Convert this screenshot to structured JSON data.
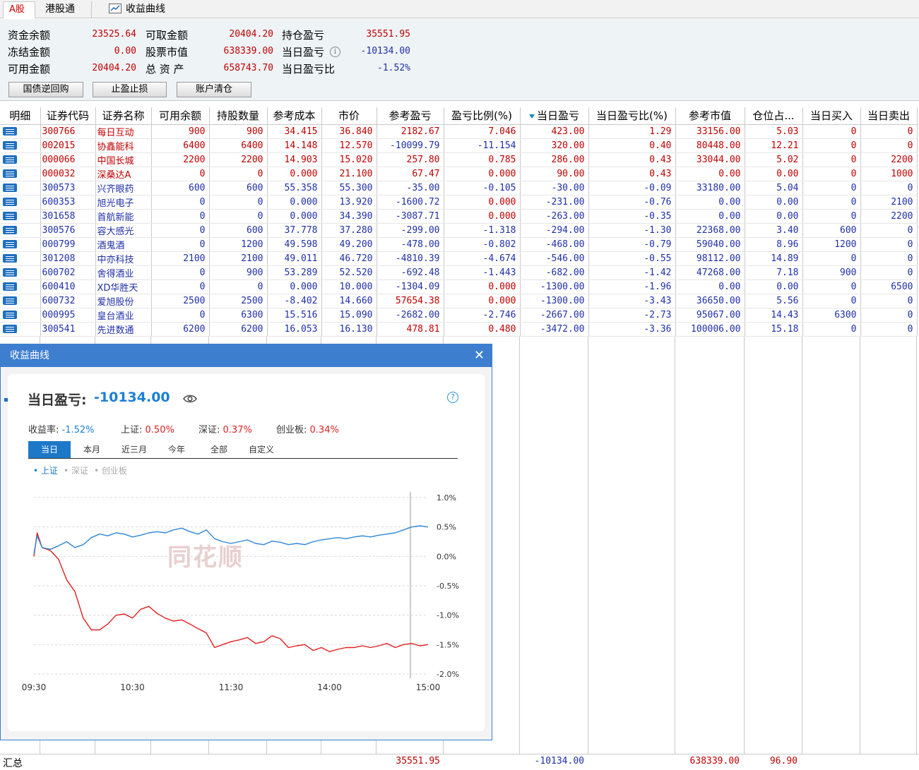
{
  "tabs": {
    "a_share": "A股",
    "hk_connect": "港股通",
    "curve": "收益曲线"
  },
  "summary": {
    "fund_balance_label": "资金余额",
    "fund_balance": "23525.64",
    "frozen_label": "冻结金额",
    "frozen": "0.00",
    "available_label": "可用金额",
    "available": "20404.20",
    "withdrawable_label": "可取金额",
    "withdrawable": "20404.20",
    "stock_value_label": "股票市值",
    "stock_value": "638339.00",
    "total_assets_label": "总 资 产",
    "total_assets": "658743.70",
    "position_pl_label": "持仓盈亏",
    "position_pl": "35551.95",
    "day_pl_label": "当日盈亏",
    "day_pl": "-10134.00",
    "day_pl_ratio_label": "当日盈亏比",
    "day_pl_ratio": "-1.52%"
  },
  "buttons": {
    "repo": "国债逆回购",
    "stop": "止盈止损",
    "clear": "账户清仓"
  },
  "columns": [
    "明细",
    "证券代码",
    "证券名称",
    "可用余额",
    "持股数量",
    "参考成本",
    "市价",
    "参考盈亏",
    "盈亏比例(%)",
    "当日盈亏",
    "当日盈亏比(%)",
    "参考市值",
    "仓位占...",
    "当日买入",
    "当日卖出"
  ],
  "rows": [
    {
      "code": "300766",
      "name": "每日互动",
      "avail": "900",
      "qty": "900",
      "cost": "34.415",
      "price": "36.840",
      "pl": "2182.67",
      "plr": "7.046",
      "dpl": "423.00",
      "dplr": "1.29",
      "mv": "33156.00",
      "pos": "5.03",
      "buy": "0",
      "sell": "0"
    },
    {
      "code": "002015",
      "name": "协鑫能科",
      "avail": "6400",
      "qty": "6400",
      "cost": "14.148",
      "price": "12.570",
      "pl": "-10099.79",
      "plr": "-11.154",
      "dpl": "320.00",
      "dplr": "0.40",
      "mv": "80448.00",
      "pos": "12.21",
      "buy": "0",
      "sell": "0"
    },
    {
      "code": "000066",
      "name": "中国长城",
      "avail": "2200",
      "qty": "2200",
      "cost": "14.903",
      "price": "15.020",
      "pl": "257.80",
      "plr": "0.785",
      "dpl": "286.00",
      "dplr": "0.43",
      "mv": "33044.00",
      "pos": "5.02",
      "buy": "0",
      "sell": "2200"
    },
    {
      "code": "000032",
      "name": "深桑达A",
      "avail": "0",
      "qty": "0",
      "cost": "0.000",
      "price": "21.100",
      "pl": "67.47",
      "plr": "0.000",
      "dpl": "90.00",
      "dplr": "0.43",
      "mv": "0.00",
      "pos": "0.00",
      "buy": "0",
      "sell": "1000"
    },
    {
      "code": "300573",
      "name": "兴齐眼药",
      "avail": "600",
      "qty": "600",
      "cost": "55.358",
      "price": "55.300",
      "pl": "-35.00",
      "plr": "-0.105",
      "dpl": "-30.00",
      "dplr": "-0.09",
      "mv": "33180.00",
      "pos": "5.04",
      "buy": "0",
      "sell": "0"
    },
    {
      "code": "600353",
      "name": "旭光电子",
      "avail": "0",
      "qty": "0",
      "cost": "0.000",
      "price": "13.920",
      "pl": "-1600.72",
      "plr": "0.000",
      "dpl": "-231.00",
      "dplr": "-0.76",
      "mv": "0.00",
      "pos": "0.00",
      "buy": "0",
      "sell": "2100"
    },
    {
      "code": "301658",
      "name": "首航新能",
      "avail": "0",
      "qty": "0",
      "cost": "0.000",
      "price": "34.390",
      "pl": "-3087.71",
      "plr": "0.000",
      "dpl": "-263.00",
      "dplr": "-0.35",
      "mv": "0.00",
      "pos": "0.00",
      "buy": "0",
      "sell": "2200"
    },
    {
      "code": "300576",
      "name": "容大感光",
      "avail": "0",
      "qty": "600",
      "cost": "37.778",
      "price": "37.280",
      "pl": "-299.00",
      "plr": "-1.318",
      "dpl": "-294.00",
      "dplr": "-1.30",
      "mv": "22368.00",
      "pos": "3.40",
      "buy": "600",
      "sell": "0"
    },
    {
      "code": "000799",
      "name": "酒鬼酒",
      "avail": "0",
      "qty": "1200",
      "cost": "49.598",
      "price": "49.200",
      "pl": "-478.00",
      "plr": "-0.802",
      "dpl": "-468.00",
      "dplr": "-0.79",
      "mv": "59040.00",
      "pos": "8.96",
      "buy": "1200",
      "sell": "0"
    },
    {
      "code": "301208",
      "name": "中亦科技",
      "avail": "2100",
      "qty": "2100",
      "cost": "49.011",
      "price": "46.720",
      "pl": "-4810.39",
      "plr": "-4.674",
      "dpl": "-546.00",
      "dplr": "-0.55",
      "mv": "98112.00",
      "pos": "14.89",
      "buy": "0",
      "sell": "0"
    },
    {
      "code": "600702",
      "name": "舍得酒业",
      "avail": "0",
      "qty": "900",
      "cost": "53.289",
      "price": "52.520",
      "pl": "-692.48",
      "plr": "-1.443",
      "dpl": "-682.00",
      "dplr": "-1.42",
      "mv": "47268.00",
      "pos": "7.18",
      "buy": "900",
      "sell": "0"
    },
    {
      "code": "600410",
      "name": "XD华胜天",
      "avail": "0",
      "qty": "0",
      "cost": "0.000",
      "price": "10.000",
      "pl": "-1304.09",
      "plr": "0.000",
      "dpl": "-1300.00",
      "dplr": "-1.96",
      "mv": "0.00",
      "pos": "0.00",
      "buy": "0",
      "sell": "6500"
    },
    {
      "code": "600732",
      "name": "爱旭股份",
      "avail": "2500",
      "qty": "2500",
      "cost": "-8.402",
      "price": "14.660",
      "pl": "57654.38",
      "plr": "0.000",
      "dpl": "-1300.00",
      "dplr": "-3.43",
      "mv": "36650.00",
      "pos": "5.56",
      "buy": "0",
      "sell": "0"
    },
    {
      "code": "000995",
      "name": "皇台酒业",
      "avail": "0",
      "qty": "6300",
      "cost": "15.516",
      "price": "15.090",
      "pl": "-2682.00",
      "plr": "-2.746",
      "dpl": "-2667.00",
      "dplr": "-2.73",
      "mv": "95067.00",
      "pos": "14.43",
      "buy": "6300",
      "sell": "0"
    },
    {
      "code": "300541",
      "name": "先进数通",
      "avail": "6200",
      "qty": "6200",
      "cost": "16.053",
      "price": "16.130",
      "pl": "478.81",
      "plr": "0.480",
      "dpl": "-3472.00",
      "dplr": "-3.36",
      "mv": "100006.00",
      "pos": "15.18",
      "buy": "0",
      "sell": "0"
    }
  ],
  "totals": {
    "label": "汇总",
    "pl": "35551.95",
    "dpl": "-10134.00",
    "mv": "638339.00",
    "pos": "96.90"
  },
  "popup": {
    "title": "收益曲线",
    "day_pl_label": "当日盈亏:",
    "day_pl_value": "-10134.00",
    "metrics": [
      {
        "label": "收益率:",
        "value": "-1.52%",
        "color": "#1c7fd6"
      },
      {
        "label": "上证:",
        "value": "0.50%",
        "color": "#e02020"
      },
      {
        "label": "深证:",
        "value": "0.37%",
        "color": "#e02020"
      },
      {
        "label": "创业板:",
        "value": "0.34%",
        "color": "#e02020"
      }
    ],
    "period_tabs": [
      "当日",
      "本月",
      "近三月",
      "今年",
      "全部",
      "自定义"
    ],
    "active_period": "当日",
    "legend": [
      {
        "label": "上证",
        "active": true
      },
      {
        "label": "深证",
        "active": false
      },
      {
        "label": "创业板",
        "active": false
      }
    ],
    "watermark": "同花顺"
  },
  "chart_data": {
    "type": "line",
    "title": "",
    "xlabel": "",
    "ylabel": "",
    "x_ticks": [
      "09:30",
      "10:30",
      "11:30",
      "14:00",
      "15:00"
    ],
    "y_ticks": [
      "1.0%",
      "0.5%",
      "0.0%",
      "-0.5%",
      "-1.0%",
      "-1.5%",
      "-2.0%"
    ],
    "ylim": [
      -2.0,
      1.0
    ],
    "series": [
      {
        "name": "收益率",
        "color": "#e02020",
        "x": [
          "09:30",
          "09:32",
          "09:35",
          "09:40",
          "09:45",
          "09:50",
          "09:55",
          "10:00",
          "10:05",
          "10:10",
          "10:15",
          "10:20",
          "10:25",
          "10:30",
          "10:35",
          "10:40",
          "10:45",
          "10:50",
          "10:55",
          "11:00",
          "11:05",
          "11:10",
          "11:15",
          "11:20",
          "11:25",
          "11:30",
          "13:05",
          "13:10",
          "13:15",
          "13:20",
          "13:25",
          "13:30",
          "13:35",
          "13:40",
          "13:45",
          "13:50",
          "13:55",
          "14:00",
          "14:05",
          "14:10",
          "14:15",
          "14:20",
          "14:25",
          "14:30",
          "14:35",
          "14:40",
          "14:45",
          "14:50",
          "14:55",
          "15:00"
        ],
        "y": [
          0.0,
          0.4,
          0.15,
          0.1,
          -0.05,
          -0.4,
          -0.6,
          -1.05,
          -1.25,
          -1.25,
          -1.15,
          -1.0,
          -0.98,
          -1.05,
          -0.9,
          -0.85,
          -0.97,
          -1.05,
          -1.1,
          -1.08,
          -1.15,
          -1.23,
          -1.3,
          -1.55,
          -1.5,
          -1.45,
          -1.42,
          -1.38,
          -1.48,
          -1.45,
          -1.35,
          -1.4,
          -1.55,
          -1.52,
          -1.5,
          -1.6,
          -1.55,
          -1.62,
          -1.58,
          -1.55,
          -1.55,
          -1.52,
          -1.55,
          -1.52,
          -1.48,
          -1.55,
          -1.5,
          -1.48,
          -1.52,
          -1.5
        ]
      },
      {
        "name": "上证",
        "color": "#2f86d6",
        "x": [
          "09:30",
          "09:32",
          "09:35",
          "09:40",
          "09:45",
          "09:50",
          "09:55",
          "10:00",
          "10:05",
          "10:10",
          "10:15",
          "10:20",
          "10:25",
          "10:30",
          "10:35",
          "10:40",
          "10:45",
          "10:50",
          "10:55",
          "11:00",
          "11:05",
          "11:10",
          "11:15",
          "11:20",
          "11:25",
          "11:30",
          "13:05",
          "13:10",
          "13:15",
          "13:20",
          "13:25",
          "13:30",
          "13:35",
          "13:40",
          "13:45",
          "13:50",
          "13:55",
          "14:00",
          "14:05",
          "14:10",
          "14:15",
          "14:20",
          "14:25",
          "14:30",
          "14:35",
          "14:40",
          "14:45",
          "14:50",
          "14:55",
          "15:00"
        ],
        "y": [
          0.05,
          0.35,
          0.15,
          0.12,
          0.18,
          0.25,
          0.15,
          0.2,
          0.32,
          0.38,
          0.35,
          0.4,
          0.38,
          0.33,
          0.36,
          0.4,
          0.42,
          0.4,
          0.45,
          0.48,
          0.42,
          0.38,
          0.45,
          0.3,
          0.25,
          0.22,
          0.25,
          0.28,
          0.22,
          0.2,
          0.26,
          0.24,
          0.2,
          0.22,
          0.2,
          0.25,
          0.28,
          0.3,
          0.32,
          0.3,
          0.33,
          0.35,
          0.33,
          0.36,
          0.38,
          0.4,
          0.45,
          0.5,
          0.52,
          0.5
        ]
      }
    ]
  }
}
